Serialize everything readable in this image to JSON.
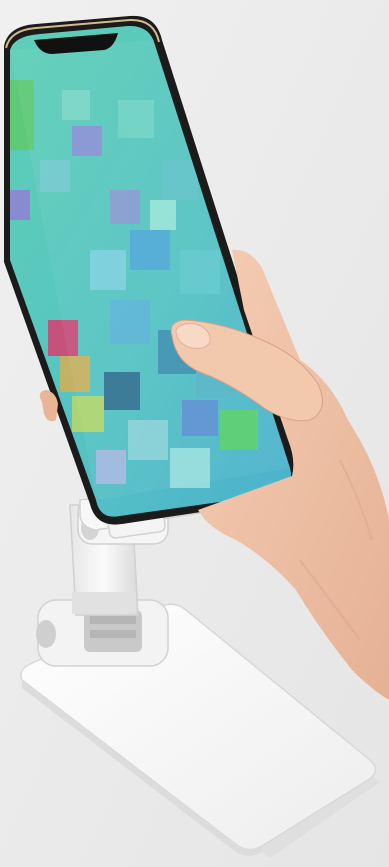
{
  "image": {
    "subject": "",
    "colors": {
      "background": "#ececec",
      "stand": "#f7f7f7",
      "stand_shadow": "#d6d6d6",
      "phone_frame": "#1b1b1b",
      "screen_base": "#58c7b9",
      "skin": "#f1c6ab",
      "skin_shadow": "#dea588"
    }
  }
}
